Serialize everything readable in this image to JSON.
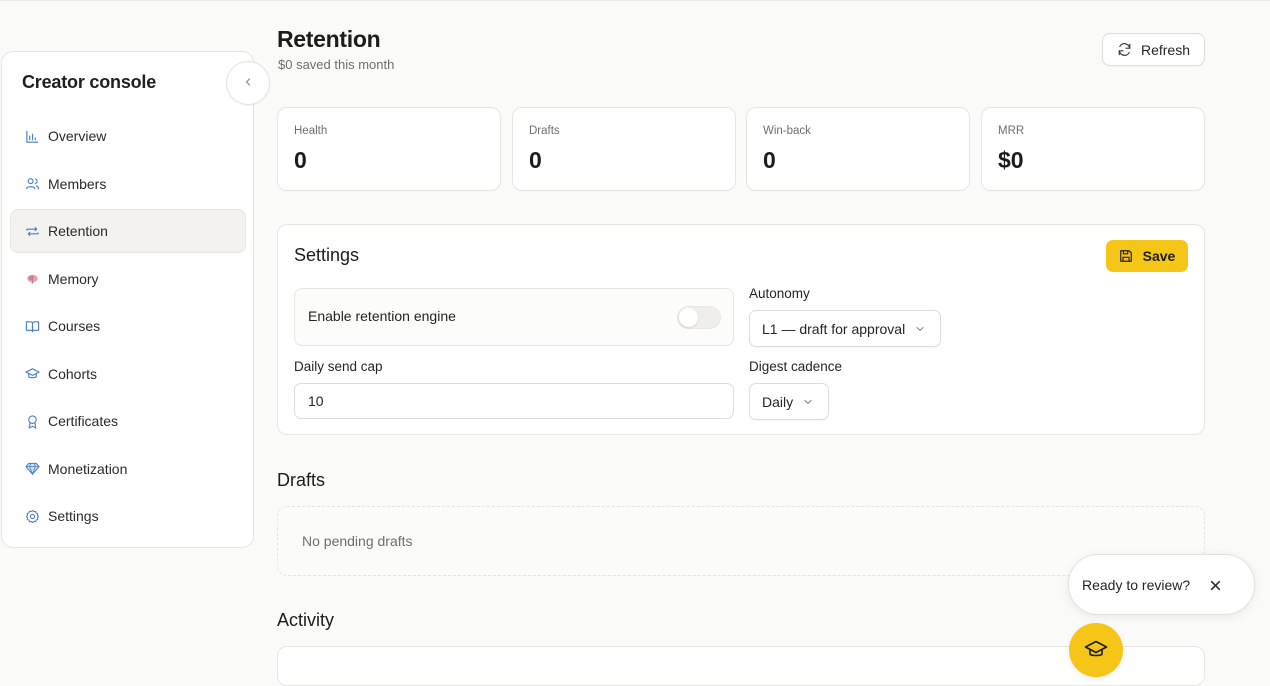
{
  "sidebar": {
    "title": "Creator console",
    "items": [
      {
        "label": "Overview",
        "icon": "bar-chart-icon"
      },
      {
        "label": "Members",
        "icon": "users-icon"
      },
      {
        "label": "Retention",
        "icon": "repeat-icon",
        "active": true
      },
      {
        "label": "Memory",
        "icon": "brain-icon"
      },
      {
        "label": "Courses",
        "icon": "book-open-icon"
      },
      {
        "label": "Cohorts",
        "icon": "graduation-cap-icon"
      },
      {
        "label": "Certificates",
        "icon": "award-icon"
      },
      {
        "label": "Monetization",
        "icon": "gem-icon"
      },
      {
        "label": "Settings",
        "icon": "gear-icon"
      }
    ]
  },
  "header": {
    "title": "Retention",
    "subtitle": "$0 saved this month",
    "refresh_label": "Refresh"
  },
  "stats": [
    {
      "label": "Health",
      "value": "0"
    },
    {
      "label": "Drafts",
      "value": "0"
    },
    {
      "label": "Win-back",
      "value": "0"
    },
    {
      "label": "MRR",
      "value": "$0"
    }
  ],
  "settings": {
    "title": "Settings",
    "save_label": "Save",
    "enable_label": "Enable retention engine",
    "enable_on": false,
    "autonomy_label": "Autonomy",
    "autonomy_value": "L1 — draft for approval",
    "daily_cap_label": "Daily send cap",
    "daily_cap_value": "10",
    "digest_label": "Digest cadence",
    "digest_value": "Daily"
  },
  "drafts": {
    "title": "Drafts",
    "empty_text": "No pending drafts"
  },
  "activity": {
    "title": "Activity"
  },
  "toast": {
    "text": "Ready to review?"
  },
  "colors": {
    "accent": "#f5c518",
    "background": "#fafaf8",
    "border": "#e6e5e0",
    "muted_text": "#6f6e6a"
  }
}
